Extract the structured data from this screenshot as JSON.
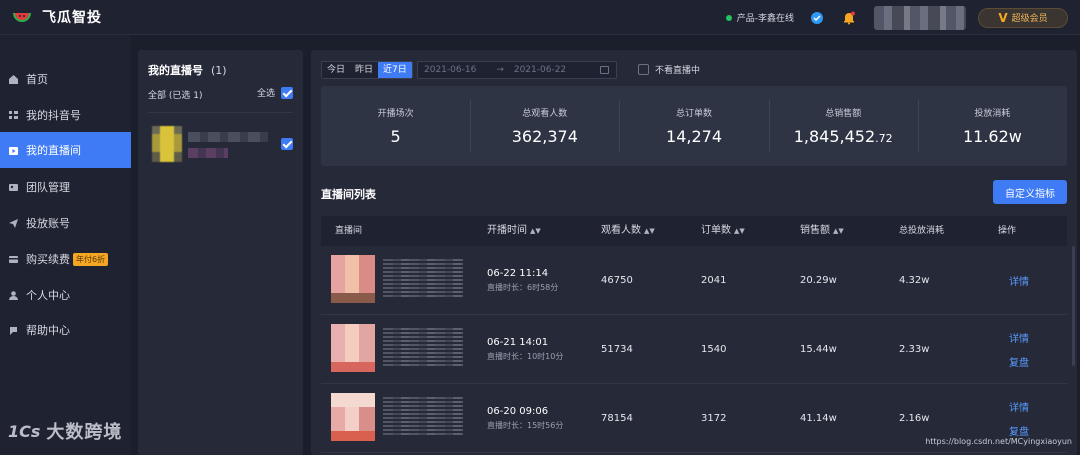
{
  "app": {
    "title": "飞瓜智投"
  },
  "header": {
    "online_status": "产品-李鑫在线",
    "vip_label": "超级会员",
    "vip_mark": "V"
  },
  "sidebar": {
    "items": [
      {
        "label": "首页",
        "icon": "home-icon"
      },
      {
        "label": "我的抖音号",
        "icon": "list-icon"
      },
      {
        "label": "我的直播间",
        "icon": "live-icon",
        "active": true
      },
      {
        "label": "团队管理",
        "icon": "team-icon"
      },
      {
        "label": "投放账号",
        "icon": "send-icon"
      },
      {
        "label": "购买续费",
        "icon": "card-icon",
        "badge": "年付6折"
      },
      {
        "label": "个人中心",
        "icon": "user-icon"
      },
      {
        "label": "帮助中心",
        "icon": "help-icon"
      }
    ]
  },
  "accounts": {
    "title": "我的直播号",
    "count": "(1)",
    "all_label": "全部",
    "selected_label": "(已选 1)",
    "select_all_label": "全选"
  },
  "filters": {
    "tabs": [
      "今日",
      "昨日",
      "近7日"
    ],
    "active_tab": "近7日",
    "date_start": "2021-06-16",
    "date_arrow": "→",
    "date_end": "2021-06-22",
    "no_live_label": "不看直播中"
  },
  "stats": [
    {
      "label": "开播场次",
      "value": "5"
    },
    {
      "label": "总观看人数",
      "value": "362,374"
    },
    {
      "label": "总订单数",
      "value": "14,274"
    },
    {
      "label": "总销售额",
      "value": "1,845,452",
      "value_decimal": ".72"
    },
    {
      "label": "投放消耗",
      "value": "11.62w"
    }
  ],
  "list": {
    "title": "直播间列表",
    "custom_button": "自定义指标",
    "columns": {
      "room": "直播间",
      "start_time": "开播时间",
      "viewers": "观看人数",
      "orders": "订单数",
      "sales": "销售额",
      "ad_spend": "总投放消耗",
      "actions": "操作"
    },
    "duration_prefix": "直播时长：",
    "rows": [
      {
        "time": "06-22 11:14",
        "duration": "6时58分",
        "viewers": "46750",
        "orders": "2041",
        "sales": "20.29w",
        "spend": "4.32w",
        "actions": [
          "详情"
        ]
      },
      {
        "time": "06-21 14:01",
        "duration": "10时10分",
        "viewers": "51734",
        "orders": "1540",
        "sales": "15.44w",
        "spend": "2.33w",
        "actions": [
          "详情",
          "复盘"
        ]
      },
      {
        "time": "06-20 09:06",
        "duration": "15时56分",
        "viewers": "78154",
        "orders": "3172",
        "sales": "41.14w",
        "spend": "2.16w",
        "actions": [
          "详情",
          "复盘"
        ]
      }
    ]
  },
  "watermark": {
    "logo": "1Cs",
    "text": "大数跨境"
  },
  "footer": {
    "url": "https://blog.csdn.net/MCyingxiaoyun"
  },
  "colors": {
    "accent": "#3e7bf4",
    "background": "#1b1e2b",
    "panel": "#252938",
    "link": "#5a9bff",
    "badge": "#f5a623"
  }
}
